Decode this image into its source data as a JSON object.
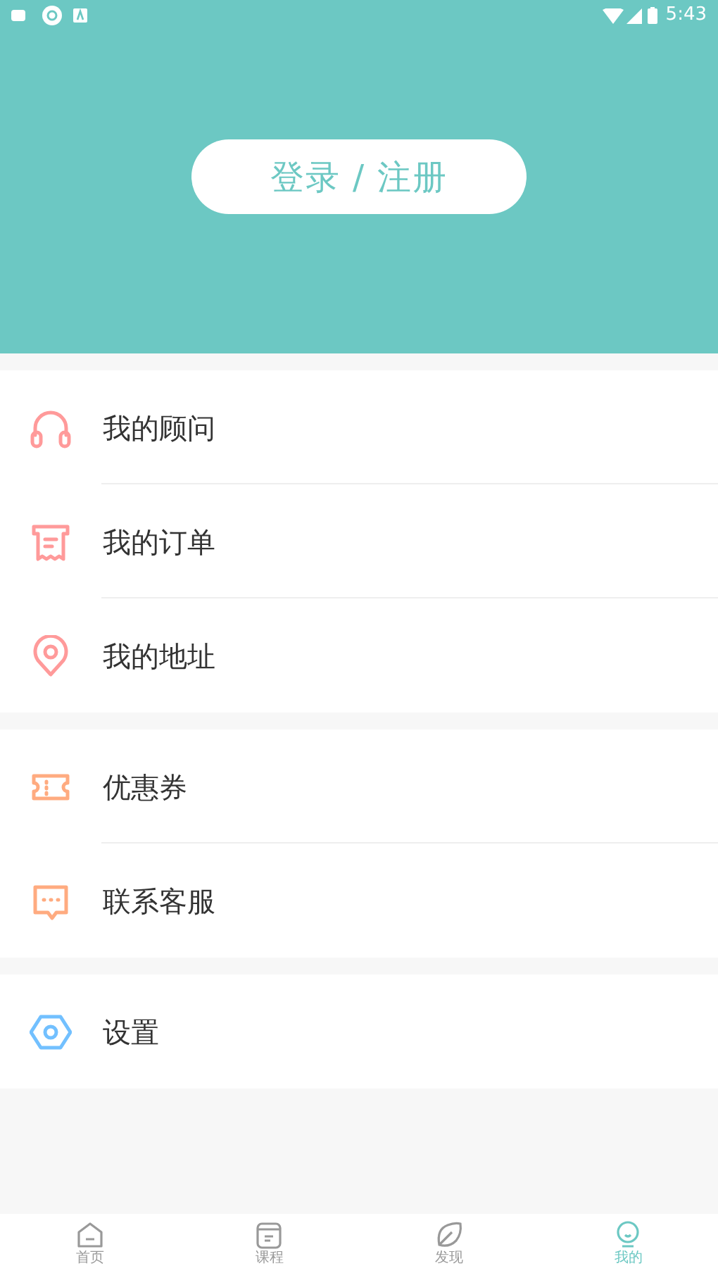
{
  "status_bar": {
    "time": "5:43"
  },
  "header": {
    "login_button": "登录 / 注册"
  },
  "menu_groups": [
    [
      {
        "label": "我的顾问",
        "color": "#ff9a9a"
      },
      {
        "label": "我的订单",
        "color": "#ff9a9a"
      },
      {
        "label": "我的地址",
        "color": "#ff9a9a"
      }
    ],
    [
      {
        "label": "优惠券",
        "color": "#ffab80"
      },
      {
        "label": "联系客服",
        "color": "#ffab80"
      }
    ],
    [
      {
        "label": "设置",
        "color": "#72c0ff"
      }
    ]
  ],
  "tabs": [
    {
      "label": "首页",
      "selected": false
    },
    {
      "label": "课程",
      "selected": false
    },
    {
      "label": "发现",
      "selected": false
    },
    {
      "label": "我的",
      "selected": true
    }
  ]
}
